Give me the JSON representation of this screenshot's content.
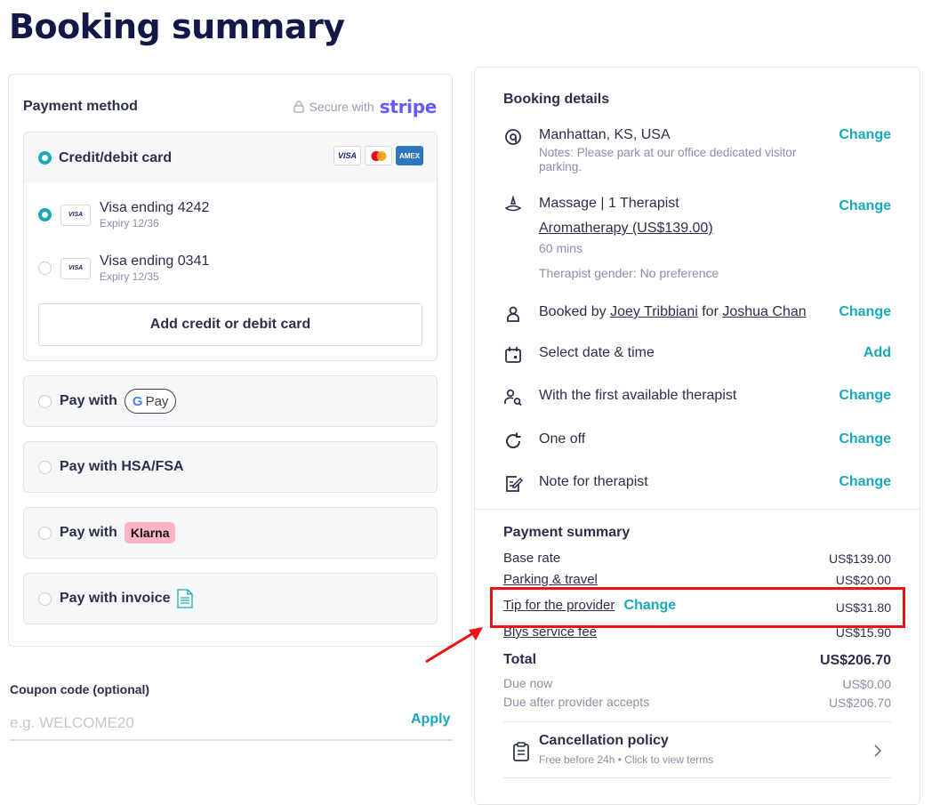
{
  "page": {
    "title": "Booking summary"
  },
  "payment": {
    "title": "Payment method",
    "secure_text": "Secure with",
    "secure_brand": "stripe",
    "card_option_label": "Credit/debit card",
    "card_brands": [
      "VISA",
      "MC",
      "AMEX"
    ],
    "saved_cards": [
      {
        "name": "Visa ending 4242",
        "expiry": "Expiry 12/36",
        "selected": true,
        "brand": "VISA"
      },
      {
        "name": "Visa ending 0341",
        "expiry": "Expiry 12/35",
        "selected": false,
        "brand": "VISA"
      }
    ],
    "add_card_label": "Add credit or debit card",
    "gpay_label": "Pay with",
    "gpay_badge": "Pay",
    "gpay_g": "G",
    "hsa_label": "Pay with HSA/FSA",
    "klarna_label": "Pay with",
    "klarna_badge": "Klarna",
    "invoice_label": "Pay with invoice"
  },
  "coupon": {
    "label": "Coupon code (optional)",
    "placeholder": "e.g. WELCOME20",
    "apply_label": "Apply"
  },
  "booking": {
    "title": "Booking details",
    "location": {
      "main": "Manhattan, KS, USA",
      "note": "Notes: Please park at our office dedicated visitor parking.",
      "action": "Change"
    },
    "service": {
      "main": "Massage | 1 Therapist",
      "treatment": "Aromatherapy (US$139.00)",
      "duration": "60 mins",
      "gender": "Therapist gender: No preference",
      "action": "Change"
    },
    "booked_by": {
      "prefix": "Booked by",
      "booker": "Joey Tribbiani",
      "for": "for",
      "client": "Joshua Chan",
      "action": "Change"
    },
    "datetime": {
      "main": "Select date & time",
      "action": "Add"
    },
    "therapist": {
      "main": "With the first available therapist",
      "action": "Change"
    },
    "frequency": {
      "main": "One off",
      "action": "Change"
    },
    "note": {
      "main": "Note for therapist",
      "action": "Change"
    }
  },
  "summary": {
    "title": "Payment summary",
    "base_rate": {
      "label": "Base rate",
      "value": "US$139.00"
    },
    "parking": {
      "label": "Parking & travel",
      "value": "US$20.00"
    },
    "tip": {
      "label": "Tip for the provider",
      "action": "Change",
      "value": "US$31.80"
    },
    "service_fee": {
      "label": "Blys service fee",
      "value": "US$15.90"
    },
    "total": {
      "label": "Total",
      "value": "US$206.70"
    },
    "due_now": {
      "label": "Due now",
      "value": "US$0.00"
    },
    "due_after": {
      "label": "Due after provider accepts",
      "value": "US$206.70"
    },
    "cancellation": {
      "title": "Cancellation policy",
      "subtitle": "Free before 24h • Click to view terms"
    }
  },
  "colors": {
    "accent": "#17a9b8",
    "title": "#121848",
    "highlight": "#ee1111",
    "stripe": "#635bff",
    "klarna": "#ffb3c7"
  }
}
